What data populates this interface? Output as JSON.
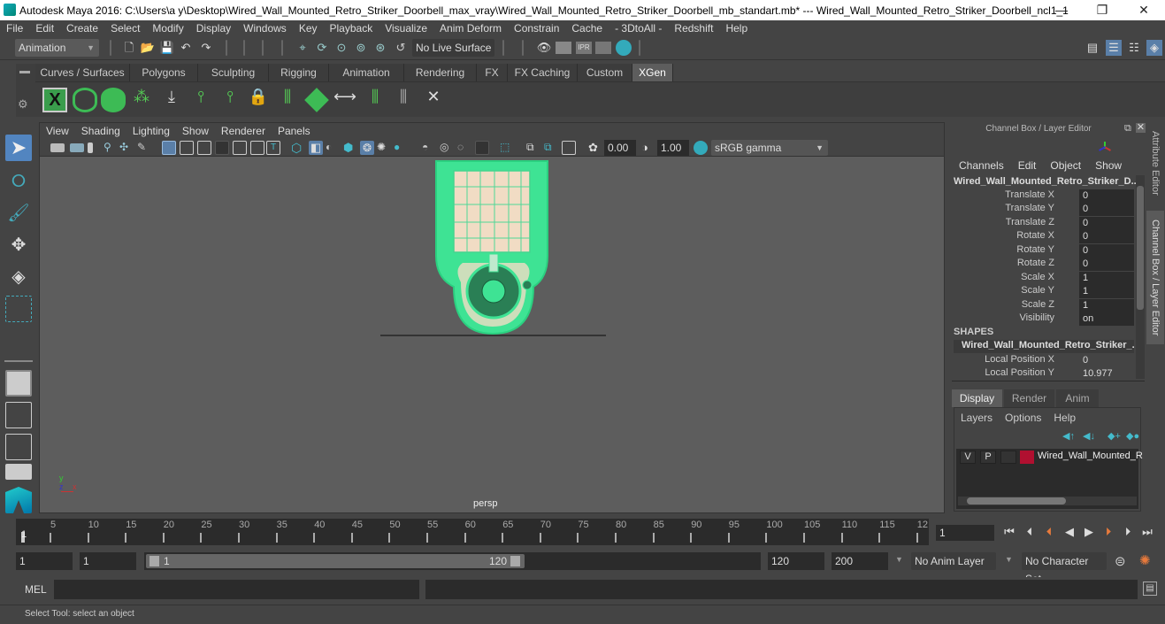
{
  "window": {
    "title": "Autodesk Maya 2016: C:\\Users\\a y\\Desktop\\Wired_Wall_Mounted_Retro_Striker_Doorbell_max_vray\\Wired_Wall_Mounted_Retro_Striker_Doorbell_mb_standart.mb*  ---  Wired_Wall_Mounted_Retro_Striker_Doorbell_ncl1_1",
    "minimize": "—",
    "restore": "❐",
    "close": "✕"
  },
  "menubar": [
    "File",
    "Edit",
    "Create",
    "Select",
    "Modify",
    "Display",
    "Windows",
    "Key",
    "Playback",
    "Visualize",
    "Anim Deform",
    "Constrain",
    "Cache",
    "- 3DtoAll -",
    "Redshift",
    "Help"
  ],
  "statusline": {
    "menuset": "Animation",
    "live_surface": "No Live Surface"
  },
  "shelf": {
    "tabs": [
      "Curves / Surfaces",
      "Polygons",
      "Sculpting",
      "Rigging",
      "Animation",
      "Rendering",
      "FX",
      "FX Caching",
      "Custom",
      "XGen"
    ],
    "active_tab": "XGen",
    "icons": [
      "xgen-editor-icon",
      "preview-visible-icon",
      "preview-hidden-icon",
      "add-primitives-icon",
      "place-guides-icon",
      "add-guide-icon",
      "show-guides-icon",
      "lock-guides-icon",
      "sculpt-guides-icon",
      "create-description-icon",
      "guide-length-icon",
      "select-guides-icon",
      "guide-clump-icon",
      "delete-guides-icon"
    ]
  },
  "viewport": {
    "menu": [
      "View",
      "Shading",
      "Lighting",
      "Show",
      "Renderer",
      "Panels"
    ],
    "exposure": "0.00",
    "gamma": "1.00",
    "colorspace": "sRGB gamma",
    "camera_label": "persp",
    "axis": {
      "y": "y",
      "z": "z",
      "x": "x"
    }
  },
  "channelbox": {
    "title": "Channel Box / Layer Editor",
    "menu": [
      "Channels",
      "Edit",
      "Object",
      "Show"
    ],
    "object_name": "Wired_Wall_Mounted_Retro_Striker_D...",
    "channels": [
      {
        "label": "Translate X",
        "value": "0"
      },
      {
        "label": "Translate Y",
        "value": "0"
      },
      {
        "label": "Translate Z",
        "value": "0"
      },
      {
        "label": "Rotate X",
        "value": "0"
      },
      {
        "label": "Rotate Y",
        "value": "0"
      },
      {
        "label": "Rotate Z",
        "value": "0"
      },
      {
        "label": "Scale X",
        "value": "1"
      },
      {
        "label": "Scale Y",
        "value": "1"
      },
      {
        "label": "Scale Z",
        "value": "1"
      },
      {
        "label": "Visibility",
        "value": "on"
      }
    ],
    "shapes_header": "SHAPES",
    "shape_name": "Wired_Wall_Mounted_Retro_Striker_...",
    "shape_channels": [
      {
        "label": "Local Position X",
        "value": "0"
      },
      {
        "label": "Local Position Y",
        "value": "10.977"
      }
    ]
  },
  "layer_editor": {
    "tabs": [
      "Display",
      "Render",
      "Anim"
    ],
    "active_tab": "Display",
    "menu": [
      "Layers",
      "Options",
      "Help"
    ],
    "layers": [
      {
        "v": "V",
        "p": "P",
        "color": "#b01030",
        "name": "Wired_Wall_Mounted_R"
      }
    ]
  },
  "side_tabs": {
    "attribute_editor": "Attribute Editor",
    "channel_box": "Channel Box / Layer Editor"
  },
  "timeline": {
    "ticks": [
      "5",
      "10",
      "15",
      "20",
      "25",
      "30",
      "35",
      "40",
      "45",
      "50",
      "55",
      "60",
      "65",
      "70",
      "75",
      "80",
      "85",
      "90",
      "95",
      "100",
      "105",
      "110",
      "115",
      "12"
    ],
    "current_marker": "1",
    "current_frame": "1"
  },
  "range": {
    "start": "1",
    "playback_start": "1",
    "slider_start": "1",
    "slider_end": "120",
    "playback_end": "120",
    "end": "200",
    "anim_layer": "No Anim Layer",
    "character_set": "No Character Set"
  },
  "cmdline": {
    "lang": "MEL"
  },
  "helpline": {
    "text": "Select Tool: select an object"
  }
}
